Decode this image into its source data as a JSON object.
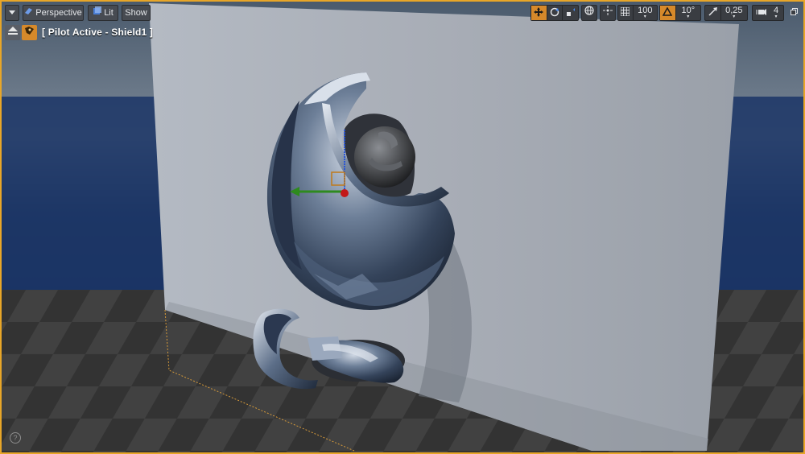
{
  "toolbar": {
    "viewport_menu_icon": "chevron-down-icon",
    "perspective_label": "Perspective",
    "lit_label": "Lit",
    "show_label": "Show",
    "grid_snap_value": "100",
    "rotation_snap_value": "10°",
    "scale_snap_value": "0,25",
    "camera_speed_value": "4",
    "accent_color": "#d6892a"
  },
  "pilot": {
    "label": "[ Pilot Active - Shield1 ]"
  },
  "help_glyph": "?"
}
